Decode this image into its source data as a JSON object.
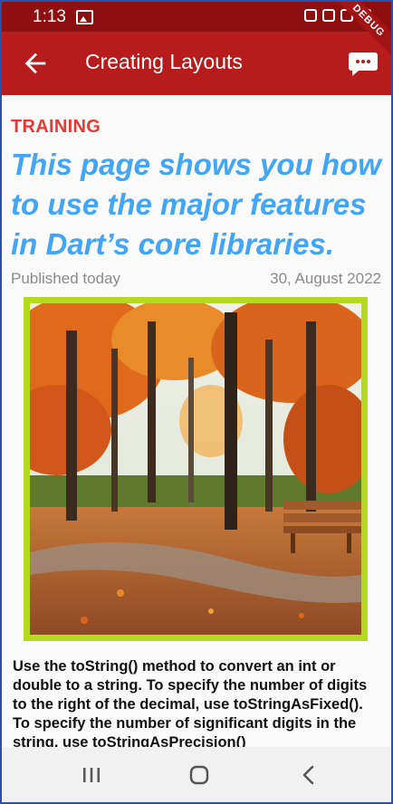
{
  "status_bar": {
    "time": "1:13"
  },
  "app_bar": {
    "title": "Creating Layouts"
  },
  "debug_banner": "DEBUG",
  "article": {
    "category": "TRAINING",
    "headline": "This page shows you how to use the major features in Dart’s core libraries.",
    "published": "Published today",
    "date": "30, August 2022",
    "body": "Use the toString() method to convert an int or double to a string. To specify the number of digits to the right of the decimal, use toStringAsFixed(). To specify the number of significant digits in the string, use toStringAsPrecision()"
  },
  "colors": {
    "status_bar": "#8e0f0f",
    "app_bar": "#b71c1c",
    "category": "#e53935",
    "headline": "#42a5f5",
    "image_border": "#b5d91e"
  },
  "icons": [
    "image-icon",
    "back-arrow-icon",
    "chat-bubble-icon",
    "recents-icon",
    "home-icon",
    "back-nav-icon"
  ]
}
